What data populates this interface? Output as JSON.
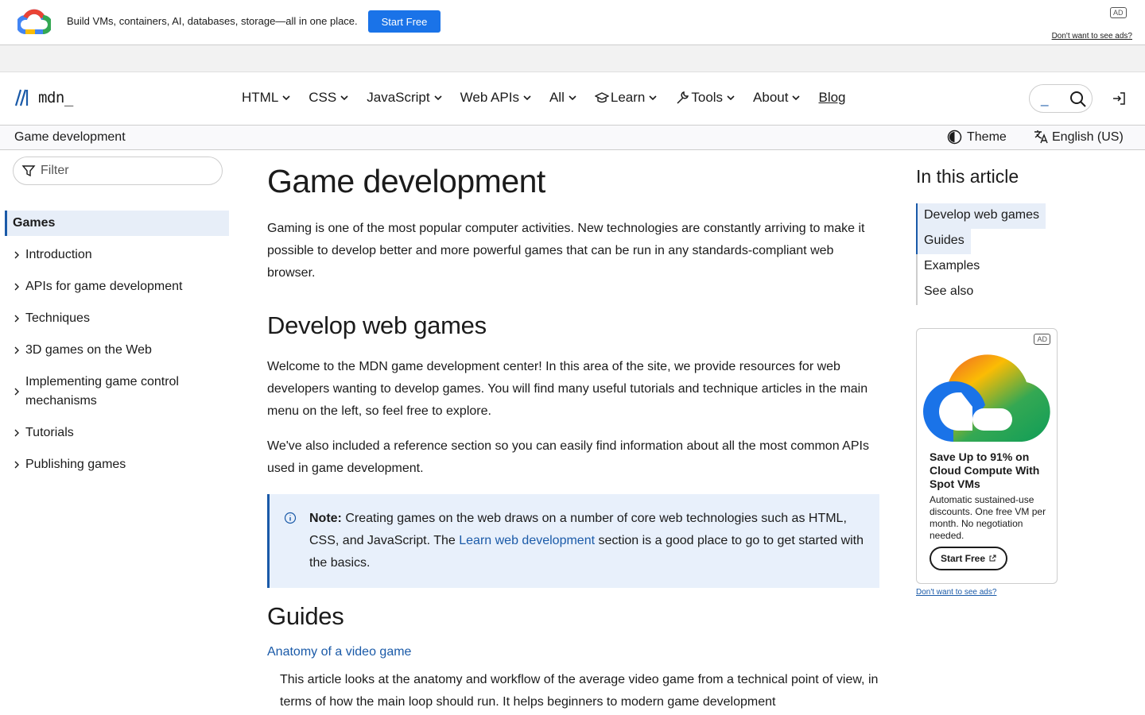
{
  "top_ad": {
    "text": "Build VMs, containers, AI, databases, storage—all in one place.",
    "button": "Start Free",
    "badge": "AD",
    "no_ads": "Don't want to see ads?"
  },
  "header": {
    "logo_text": "mdn_",
    "nav": [
      {
        "label": "HTML"
      },
      {
        "label": "CSS"
      },
      {
        "label": "JavaScript"
      },
      {
        "label": "Web APIs"
      },
      {
        "label": "All"
      },
      {
        "label": "Learn"
      },
      {
        "label": "Tools"
      },
      {
        "label": "About"
      }
    ],
    "blog": "Blog",
    "search_value": "_"
  },
  "breadcrumb": {
    "current": "Game development",
    "theme": "Theme",
    "language": "English (US)"
  },
  "sidebar": {
    "filter_placeholder": "Filter",
    "active": "Games",
    "items": [
      {
        "label": "Introduction"
      },
      {
        "label": "APIs for game development"
      },
      {
        "label": "Techniques"
      },
      {
        "label": "3D games on the Web"
      },
      {
        "label": "Implementing game control mechanisms"
      },
      {
        "label": "Tutorials"
      },
      {
        "label": "Publishing games"
      }
    ]
  },
  "main": {
    "title": "Game development",
    "intro": "Gaming is one of the most popular computer activities. New technologies are constantly arriving to make it possible to develop better and more powerful games that can be run in any standards-compliant web browser.",
    "h_develop": "Develop web games",
    "welcome": "Welcome to the MDN game development center! In this area of the site, we provide resources for web developers wanting to develop games. You will find many useful tutorials and technique articles in the main menu on the left, so feel free to explore.",
    "also": "We've also included a reference section so you can easily find information about all the most common APIs used in game development.",
    "note": {
      "label": "Note:",
      "text_before": " Creating games on the web draws on a number of core web technologies such as HTML, CSS, and JavaScript. The ",
      "link": "Learn web development",
      "text_after": " section is a good place to go to get started with the basics."
    },
    "h_guides": "Guides",
    "guide_link": "Anatomy of a video game",
    "guide_desc": "This article looks at the anatomy and workflow of the average video game from a technical point of view, in terms of how the main loop should run. It helps beginners to modern game development"
  },
  "toc": {
    "title": "In this article",
    "items": [
      {
        "label": "Develop web games"
      },
      {
        "label": "Guides"
      },
      {
        "label": "Examples"
      },
      {
        "label": "See also"
      }
    ]
  },
  "side_ad": {
    "badge": "AD",
    "headline": "Save Up to 91% on Cloud Compute With Spot VMs",
    "body": "Automatic sustained-use discounts. One free VM per month. No negotiation needed.",
    "button": "Start Free",
    "no_ads": "Don't want to see ads?"
  }
}
